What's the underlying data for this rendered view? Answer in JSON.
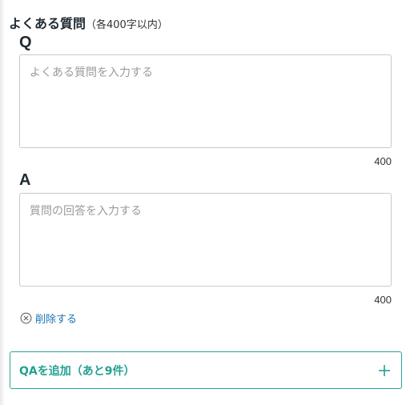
{
  "section": {
    "title": "よくある質問",
    "note": "（各400字以内）"
  },
  "qa": {
    "q_label": "Q",
    "q_placeholder": "よくある質問を入力する",
    "q_counter": "400",
    "a_label": "A",
    "a_placeholder": "質問の回答を入力する",
    "a_counter": "400"
  },
  "actions": {
    "delete_label": "削除する",
    "add_label": "QAを追加（あと9件）"
  },
  "icons": {
    "delete": "circle-x-icon",
    "add": "plus-icon"
  },
  "colors": {
    "accent": "#23a092",
    "link": "#1a73b5"
  }
}
